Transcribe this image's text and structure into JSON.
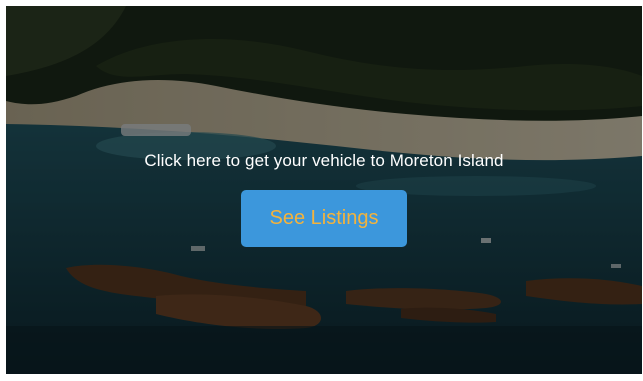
{
  "hero": {
    "background_image": "aerial-island-shipwrecks-image",
    "message": "Click here to get your vehicle to Moreton Island",
    "button_label": "See Listings"
  },
  "colors": {
    "button_bg": "#3c97dc",
    "button_text": "#f3b33d",
    "message_text": "#ffffff",
    "overlay": "rgba(0,0,0,0.42)"
  }
}
